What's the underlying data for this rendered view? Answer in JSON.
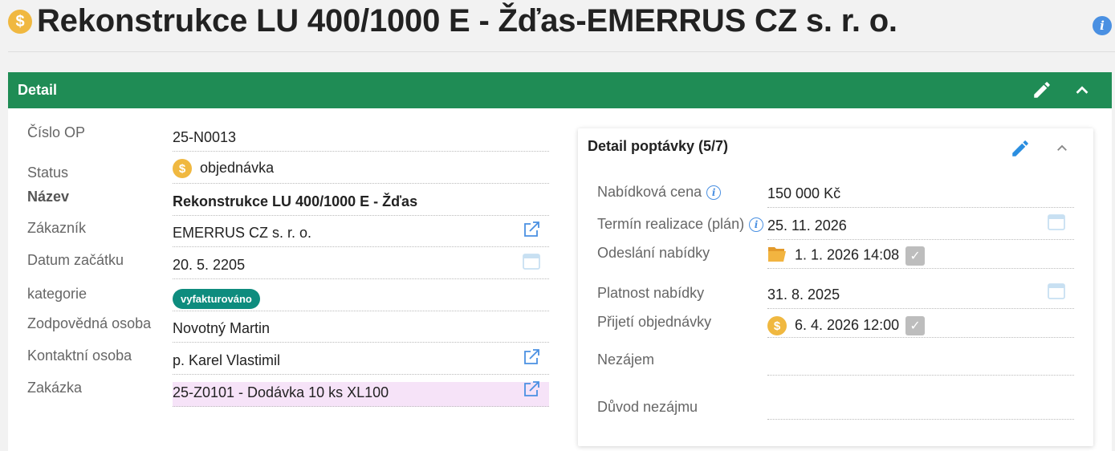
{
  "page": {
    "title": "Rekonstrukce LU 400/1000 E - Žďas-EMERRUS CZ s. r. o.",
    "title_icon": "dollar-coin-icon",
    "info_icon": "info-icon"
  },
  "panel": {
    "header": "Detail",
    "accent": "#1f8c55"
  },
  "detail": {
    "cislo_op": {
      "label": "Číslo OP",
      "value": "25-N0013"
    },
    "status": {
      "label": "Status",
      "value": "objednávka"
    },
    "nazev": {
      "label": "Název",
      "value": "Rekonstrukce LU 400/1000 E - Žďas"
    },
    "zakaznik": {
      "label": "Zákazník",
      "value": "EMERRUS CZ s. r. o."
    },
    "datum": {
      "label": "Datum začátku",
      "value": "20. 5. 2205"
    },
    "kategorie": {
      "label": "kategorie",
      "value": "vyfakturováno"
    },
    "zodpovedna": {
      "label": "Zodpovědná osoba",
      "value": "Novotný Martin"
    },
    "kontaktni": {
      "label": "Kontaktní osoba",
      "value": "p. Karel Vlastimil"
    },
    "zakazka": {
      "label": "Zakázka",
      "value": "25-Z0101 - Dodávka 10 ks XL100"
    }
  },
  "card": {
    "title": "Detail poptávky (5/7)",
    "cena": {
      "label": "Nabídková cena",
      "value": "150 000 Kč"
    },
    "termin": {
      "label": "Termín realizace (plán)",
      "value": "25. 11. 2026"
    },
    "odeslani": {
      "label": "Odeslání nabídky",
      "value": "1. 1. 2026 14:08"
    },
    "platnost": {
      "label": "Platnost nabídky",
      "value": "31. 8. 2025"
    },
    "prijeti": {
      "label": "Přijetí objednávky",
      "value": "6. 4. 2026 12:00"
    },
    "nezajem": {
      "label": "Nezájem",
      "value": ""
    },
    "duvod": {
      "label": "Důvod nezájmu",
      "value": ""
    }
  },
  "colors": {
    "badge": "#0e8c7e",
    "pink_highlight": "#f6e3f8",
    "link_blue": "#4a90e2"
  }
}
